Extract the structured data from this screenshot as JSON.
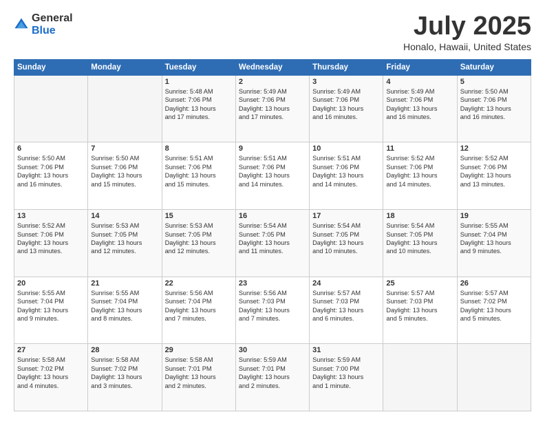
{
  "logo": {
    "general": "General",
    "blue": "Blue"
  },
  "title": "July 2025",
  "location": "Honalo, Hawaii, United States",
  "days_of_week": [
    "Sunday",
    "Monday",
    "Tuesday",
    "Wednesday",
    "Thursday",
    "Friday",
    "Saturday"
  ],
  "weeks": [
    [
      {
        "day": "",
        "info": ""
      },
      {
        "day": "",
        "info": ""
      },
      {
        "day": "1",
        "info": "Sunrise: 5:48 AM\nSunset: 7:06 PM\nDaylight: 13 hours\nand 17 minutes."
      },
      {
        "day": "2",
        "info": "Sunrise: 5:49 AM\nSunset: 7:06 PM\nDaylight: 13 hours\nand 17 minutes."
      },
      {
        "day": "3",
        "info": "Sunrise: 5:49 AM\nSunset: 7:06 PM\nDaylight: 13 hours\nand 16 minutes."
      },
      {
        "day": "4",
        "info": "Sunrise: 5:49 AM\nSunset: 7:06 PM\nDaylight: 13 hours\nand 16 minutes."
      },
      {
        "day": "5",
        "info": "Sunrise: 5:50 AM\nSunset: 7:06 PM\nDaylight: 13 hours\nand 16 minutes."
      }
    ],
    [
      {
        "day": "6",
        "info": "Sunrise: 5:50 AM\nSunset: 7:06 PM\nDaylight: 13 hours\nand 16 minutes."
      },
      {
        "day": "7",
        "info": "Sunrise: 5:50 AM\nSunset: 7:06 PM\nDaylight: 13 hours\nand 15 minutes."
      },
      {
        "day": "8",
        "info": "Sunrise: 5:51 AM\nSunset: 7:06 PM\nDaylight: 13 hours\nand 15 minutes."
      },
      {
        "day": "9",
        "info": "Sunrise: 5:51 AM\nSunset: 7:06 PM\nDaylight: 13 hours\nand 14 minutes."
      },
      {
        "day": "10",
        "info": "Sunrise: 5:51 AM\nSunset: 7:06 PM\nDaylight: 13 hours\nand 14 minutes."
      },
      {
        "day": "11",
        "info": "Sunrise: 5:52 AM\nSunset: 7:06 PM\nDaylight: 13 hours\nand 14 minutes."
      },
      {
        "day": "12",
        "info": "Sunrise: 5:52 AM\nSunset: 7:06 PM\nDaylight: 13 hours\nand 13 minutes."
      }
    ],
    [
      {
        "day": "13",
        "info": "Sunrise: 5:52 AM\nSunset: 7:06 PM\nDaylight: 13 hours\nand 13 minutes."
      },
      {
        "day": "14",
        "info": "Sunrise: 5:53 AM\nSunset: 7:05 PM\nDaylight: 13 hours\nand 12 minutes."
      },
      {
        "day": "15",
        "info": "Sunrise: 5:53 AM\nSunset: 7:05 PM\nDaylight: 13 hours\nand 12 minutes."
      },
      {
        "day": "16",
        "info": "Sunrise: 5:54 AM\nSunset: 7:05 PM\nDaylight: 13 hours\nand 11 minutes."
      },
      {
        "day": "17",
        "info": "Sunrise: 5:54 AM\nSunset: 7:05 PM\nDaylight: 13 hours\nand 10 minutes."
      },
      {
        "day": "18",
        "info": "Sunrise: 5:54 AM\nSunset: 7:05 PM\nDaylight: 13 hours\nand 10 minutes."
      },
      {
        "day": "19",
        "info": "Sunrise: 5:55 AM\nSunset: 7:04 PM\nDaylight: 13 hours\nand 9 minutes."
      }
    ],
    [
      {
        "day": "20",
        "info": "Sunrise: 5:55 AM\nSunset: 7:04 PM\nDaylight: 13 hours\nand 9 minutes."
      },
      {
        "day": "21",
        "info": "Sunrise: 5:55 AM\nSunset: 7:04 PM\nDaylight: 13 hours\nand 8 minutes."
      },
      {
        "day": "22",
        "info": "Sunrise: 5:56 AM\nSunset: 7:04 PM\nDaylight: 13 hours\nand 7 minutes."
      },
      {
        "day": "23",
        "info": "Sunrise: 5:56 AM\nSunset: 7:03 PM\nDaylight: 13 hours\nand 7 minutes."
      },
      {
        "day": "24",
        "info": "Sunrise: 5:57 AM\nSunset: 7:03 PM\nDaylight: 13 hours\nand 6 minutes."
      },
      {
        "day": "25",
        "info": "Sunrise: 5:57 AM\nSunset: 7:03 PM\nDaylight: 13 hours\nand 5 minutes."
      },
      {
        "day": "26",
        "info": "Sunrise: 5:57 AM\nSunset: 7:02 PM\nDaylight: 13 hours\nand 5 minutes."
      }
    ],
    [
      {
        "day": "27",
        "info": "Sunrise: 5:58 AM\nSunset: 7:02 PM\nDaylight: 13 hours\nand 4 minutes."
      },
      {
        "day": "28",
        "info": "Sunrise: 5:58 AM\nSunset: 7:02 PM\nDaylight: 13 hours\nand 3 minutes."
      },
      {
        "day": "29",
        "info": "Sunrise: 5:58 AM\nSunset: 7:01 PM\nDaylight: 13 hours\nand 2 minutes."
      },
      {
        "day": "30",
        "info": "Sunrise: 5:59 AM\nSunset: 7:01 PM\nDaylight: 13 hours\nand 2 minutes."
      },
      {
        "day": "31",
        "info": "Sunrise: 5:59 AM\nSunset: 7:00 PM\nDaylight: 13 hours\nand 1 minute."
      },
      {
        "day": "",
        "info": ""
      },
      {
        "day": "",
        "info": ""
      }
    ]
  ]
}
